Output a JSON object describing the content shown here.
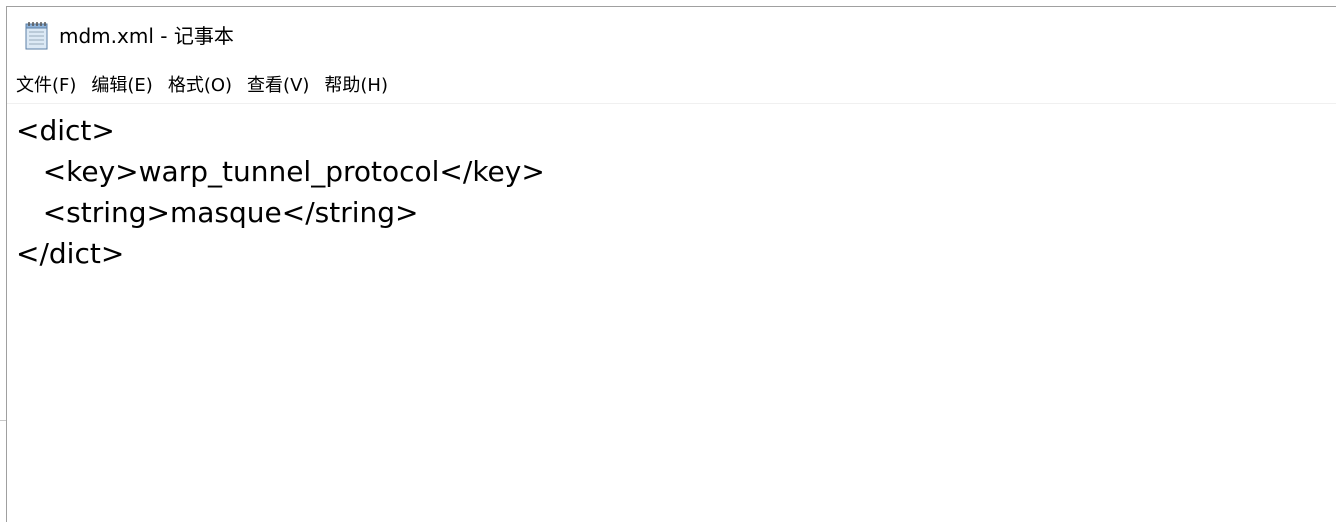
{
  "window": {
    "title": "mdm.xml - 记事本",
    "icon": "notepad-icon"
  },
  "menu": [
    {
      "label": "文件(F)"
    },
    {
      "label": "编辑(E)"
    },
    {
      "label": "格式(O)"
    },
    {
      "label": "查看(V)"
    },
    {
      "label": "帮助(H)"
    }
  ],
  "editor": {
    "lines": [
      "<dict>",
      "   <key>warp_tunnel_protocol</key>",
      "   <string>masque</string>",
      "</dict>"
    ]
  }
}
